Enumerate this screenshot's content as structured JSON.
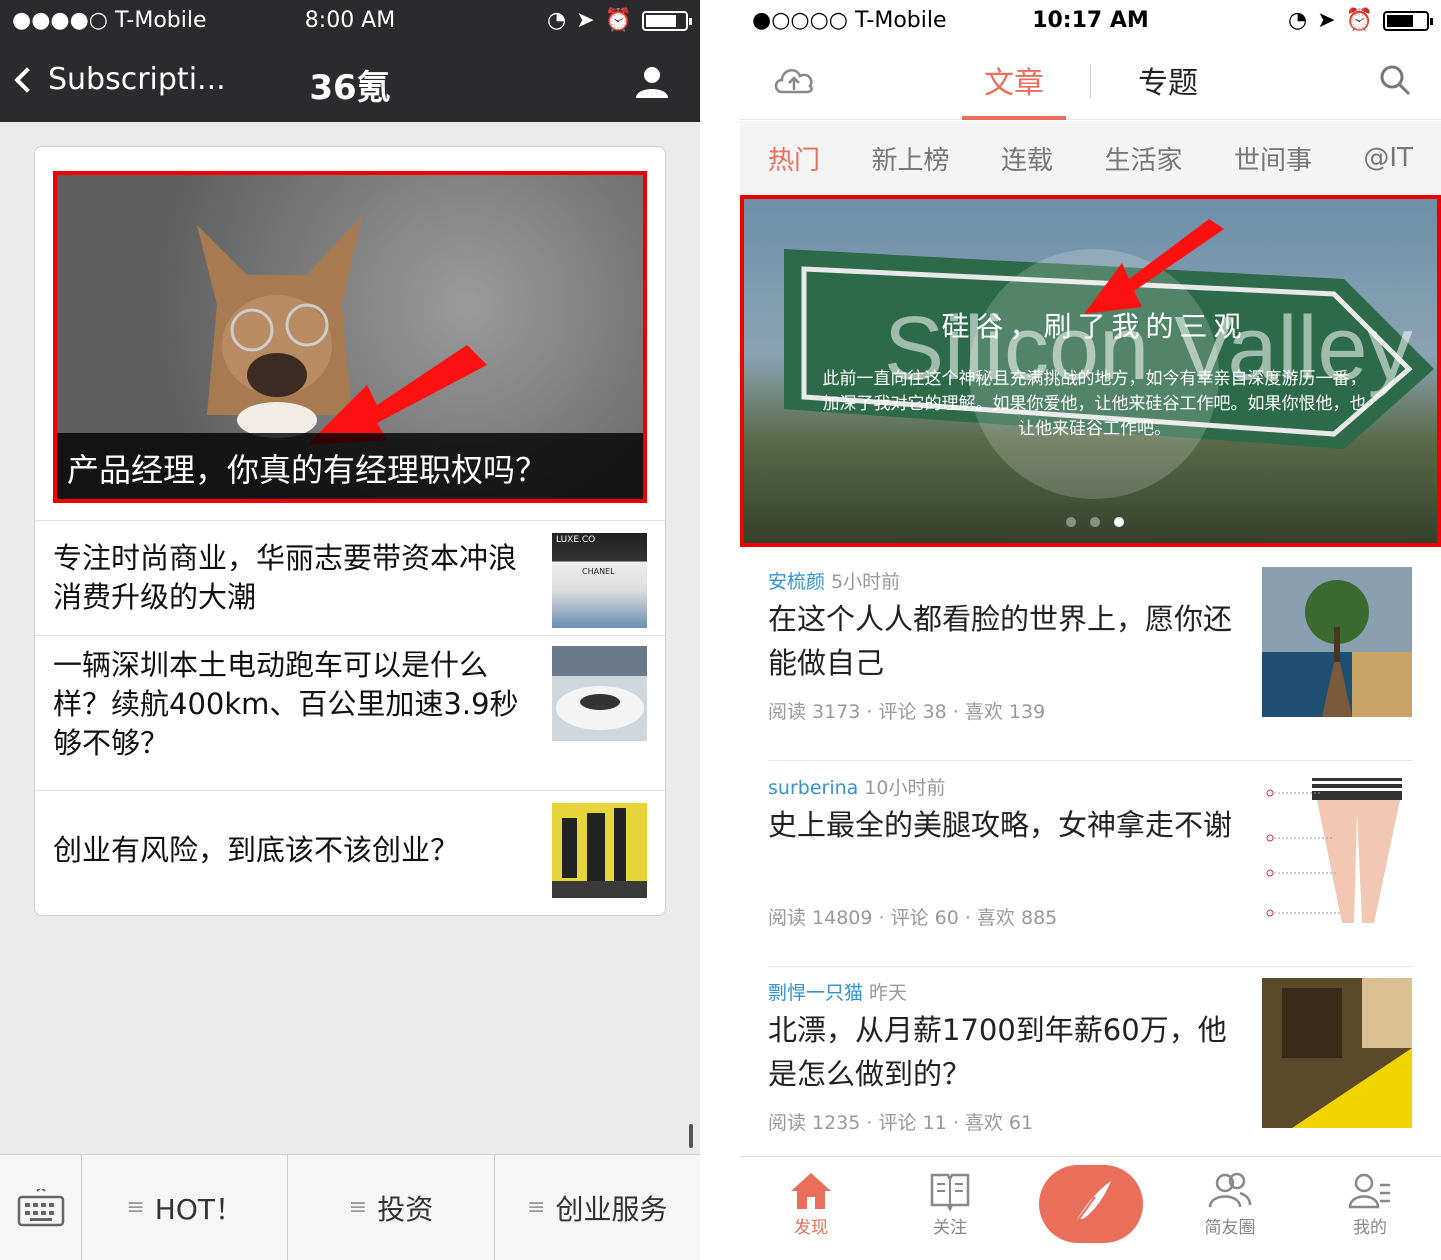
{
  "left": {
    "status": {
      "carrier": "●●●●○ T-Mobile",
      "time": "8:00 AM"
    },
    "nav": {
      "back_label": "Subscripti...",
      "title": "36氪"
    },
    "hero": {
      "caption": "产品经理，你真的有经理职权吗？"
    },
    "articles": [
      {
        "title": "专注时尚商业，华丽志要带资本冲浪消费升级的大潮",
        "thumb_text": "LUXE.CO",
        "thumb_sub": "CHANEL"
      },
      {
        "title": "一辆深圳本土电动跑车可以是什么样？续航400km、百公里加速3.9秒够不够？"
      },
      {
        "title": "创业有风险，到底该不该创业？"
      }
    ],
    "menu": [
      {
        "label": "HOT！"
      },
      {
        "label": "投资"
      },
      {
        "label": "创业服务"
      }
    ]
  },
  "right": {
    "status": {
      "carrier": "●○○○○ T-Mobile",
      "time": "10:17 AM"
    },
    "tabs": {
      "articles": "文章",
      "topics": "专题"
    },
    "categories": [
      "热门",
      "新上榜",
      "连载",
      "生活家",
      "世间事",
      "@IT"
    ],
    "banner": {
      "title": "硅谷，刷了我的三观",
      "desc": "此前一直向往这个神秘且充满挑战的地方，如今有幸亲自深度游历一番，加深了我对它的理解。如果你爱他，让他来硅谷工作吧。如果你恨他，也让他来硅谷工作吧。",
      "sign_text": "Silicon Valley"
    },
    "articles": [
      {
        "author": "安梳颜",
        "ago": "5小时前",
        "title": "在这个人人都看脸的世界上，愿你还能做自己",
        "stats": "阅读 3173 · 评论 38 · 喜欢 139"
      },
      {
        "author": "surberina",
        "ago": "10小时前",
        "title": "史上最全的美腿攻略，女神拿走不谢",
        "stats": "阅读 14809 · 评论 60 · 喜欢 885"
      },
      {
        "author": "剽悍一只猫",
        "ago": "昨天",
        "title": "北漂，从月薪1700到年薪60万，他是怎么做到的？",
        "stats": "阅读 1235 · 评论 11 · 喜欢 61"
      }
    ],
    "tabbar": {
      "discover": "发现",
      "follow": "关注",
      "friends": "简友圈",
      "me": "我的"
    }
  },
  "colors": {
    "accent": "#ea6f5a",
    "link": "#3194d0",
    "highlight": "#ee0000",
    "wechat_bar": "#2b2b2d"
  }
}
